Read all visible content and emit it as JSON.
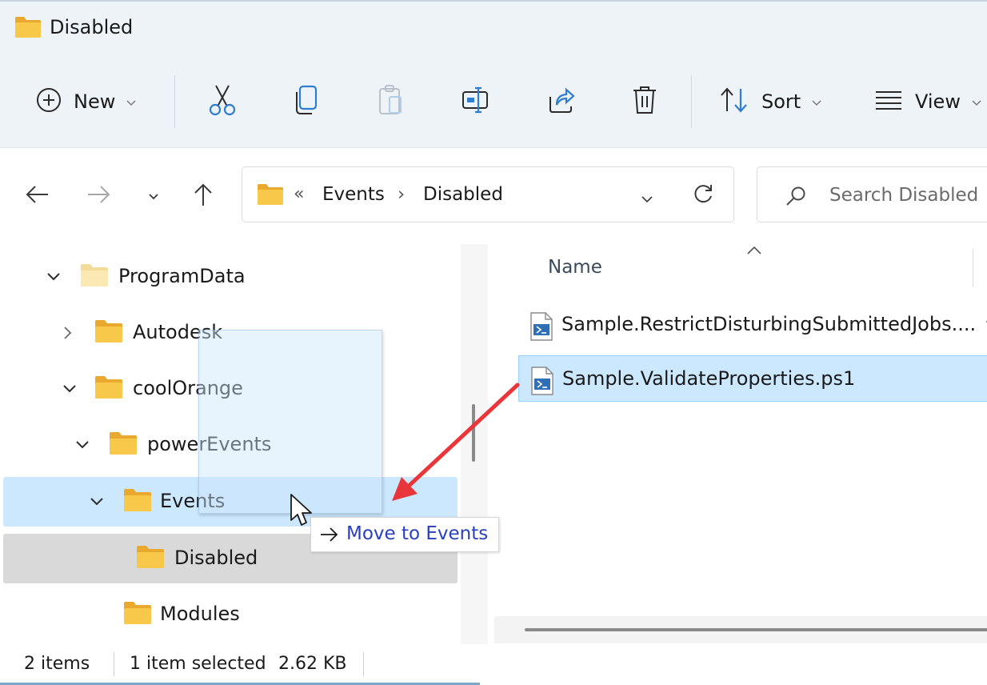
{
  "window": {
    "title": "Disabled"
  },
  "toolbar": {
    "new_label": "New",
    "sort_label": "Sort",
    "view_label": "View",
    "icons": [
      "plus-circle-icon",
      "cut-icon",
      "copy-icon",
      "paste-icon",
      "rename-icon",
      "share-icon",
      "delete-icon",
      "sort-icon",
      "view-icon"
    ]
  },
  "address": {
    "overflow": "«",
    "crumbs": [
      "Events",
      "Disabled"
    ],
    "separator": "›"
  },
  "search": {
    "placeholder": "Search Disabled"
  },
  "tree": {
    "items": [
      {
        "label": "ProgramData",
        "state": "expanded"
      },
      {
        "label": "Autodesk",
        "state": "collapsed"
      },
      {
        "label": "coolOrange",
        "state": "expanded"
      },
      {
        "label": "powerEvents",
        "state": "expanded"
      },
      {
        "label": "Events",
        "state": "expanded",
        "highlight": "drop-target"
      },
      {
        "label": "Disabled",
        "state": "leaf",
        "highlight": "selected"
      },
      {
        "label": "Modules",
        "state": "leaf"
      }
    ]
  },
  "files": {
    "column_name": "Name",
    "rows": [
      {
        "name": "Sample.RestrictDisturbingSubmittedJobs....",
        "selected": false
      },
      {
        "name": "Sample.ValidateProperties.ps1",
        "selected": true
      }
    ]
  },
  "drag": {
    "tooltip": "Move to Events",
    "arrow_color": "#e8363a"
  },
  "status": {
    "item_count": "2 items",
    "selection": "1 item selected",
    "size": "2.62 KB"
  },
  "colors": {
    "accent": "#0067c0",
    "folder": "#f6c346",
    "selection": "#cce8ff",
    "tree_selected": "#d9d9d9",
    "chrome": "#eef3f8"
  }
}
